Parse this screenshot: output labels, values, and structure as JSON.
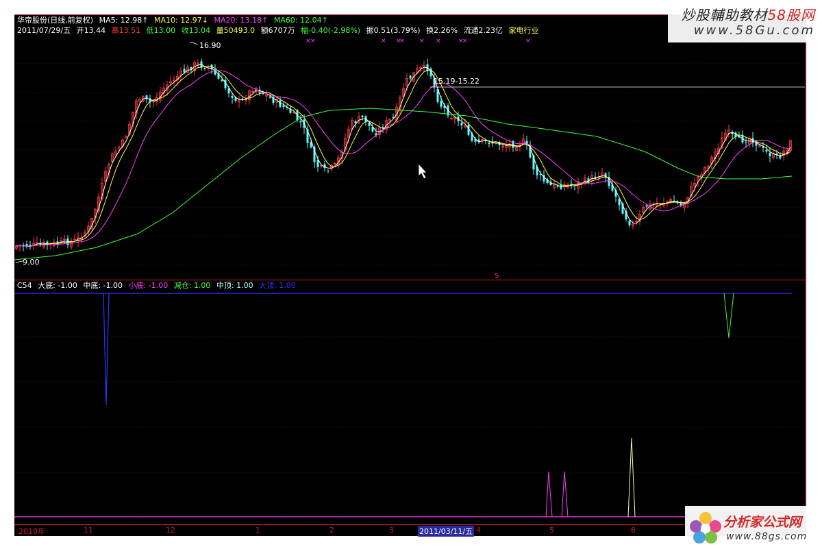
{
  "header": {
    "stock_name": "华帝股份(日线,前复权)",
    "ma5": "MA5: 12.98↑",
    "ma10": "MA10: 12.97↓",
    "ma20": "MA20: 13.18↑",
    "ma60": "MA60: 12.04↑",
    "date": "2011/07/29/五",
    "open": "开13.44",
    "high": "高13.51",
    "low": "低13.00",
    "close": "收13.04",
    "volume": "量50493.0",
    "amount": "额6707万",
    "change": "幅-0.40(-2.98%)",
    "amplitude": "振0.51(3.79%)",
    "turnover": "换2.26%",
    "float_cap": "流通2.23亿",
    "industry": "家电行业"
  },
  "indicator": {
    "name": "C54",
    "dadi": "大底: -1.00",
    "zhongdi": "中底: -1.00",
    "xiaodi": "小底: -1.00",
    "jiancang": "减仓: 1.00",
    "zhongding": "中顶: 1.00",
    "dading": "大顶: 1.00"
  },
  "price_labels": {
    "high_label": "16.90",
    "low_label": "9.00",
    "resistance": "15.19-15.22",
    "s_marker": "S"
  },
  "dates": [
    "2010年",
    "11",
    "12",
    "1",
    "2",
    "3",
    "2011/03/11/五",
    "4",
    "5",
    "6"
  ],
  "colors": {
    "up": "#ff3c3c",
    "down": "#54ffff",
    "ma5": "#ffffff",
    "ma10": "#ffff40",
    "ma20": "#ff40ff",
    "ma60": "#40ff40",
    "border": "#c8202e",
    "dadi": "#3030ff",
    "zhongdi": "#ffffff",
    "xiaodi": "#ff40ff",
    "jiancang": "#40ff40",
    "zhongding": "#c0ffff",
    "dading": "#3030ff"
  },
  "watermarks": {
    "top_title_a": "炒股輔助教材",
    "top_title_b": "58股网",
    "top_url": "www.58Gu.com",
    "bottom_title": "分析家公式网",
    "bottom_url": "www.88gs.com"
  }
}
